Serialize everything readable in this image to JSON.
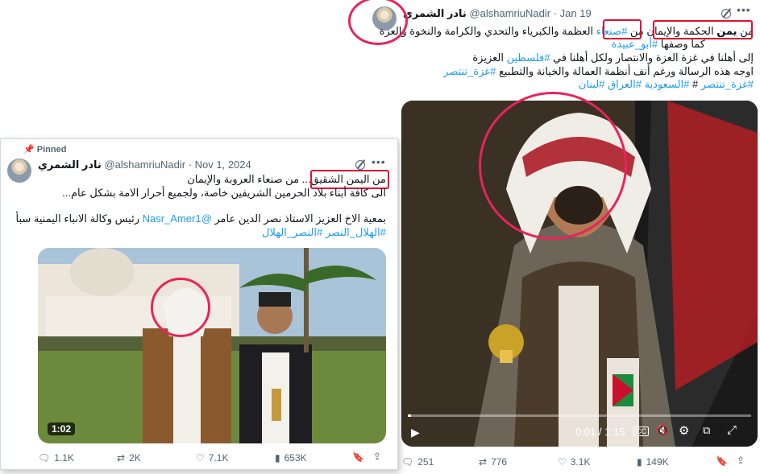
{
  "right_tweet": {
    "name": "نادر الشمري",
    "handle": "@alshamriuNadir",
    "date": "Jan 19",
    "line1": {
      "before": "من ",
      "bold": "يمن",
      "highlight": " الحكمة والإيمان",
      "mid": " من ",
      "hashtag": "#صنعاء",
      "after": " العظمة والكبرياء والتحدي والكرامة والنخوة والعزة"
    },
    "line2": {
      "text": "كما وصفها ",
      "hashtag": "#أبو_عبيدة"
    },
    "line3": {
      "text": "إلى أهلنا في غزة العزة والانتصار ولكل أهلنا في ",
      "hashtag": "#فلسطين",
      "after": " العزيزة"
    },
    "line4": {
      "text": "اوجه هذه الرسالة ورغم أنف أنظمة العمالة والخيانة والتطبيع ",
      "hashtag": "#غزة_تنتصر"
    },
    "line5": {
      "tags": [
        "#غزة_تنتصر",
        "#",
        "#السعودية",
        "#العراق",
        "#لبنان"
      ]
    },
    "video": {
      "time": "0:01 / 1:15",
      "cc": "CC"
    },
    "actions": {
      "replies": "251",
      "reposts": "776",
      "likes": "3.1K",
      "views": "149K"
    }
  },
  "left_tweet": {
    "pinned_label": "Pinned",
    "name": "نادر الشمري",
    "handle": "@alshamriuNadir",
    "date": "Nov 1, 2024",
    "line1": {
      "highlight": "من اليمن الشقيق",
      "after": "... من صنعاء العروبة والإيمان"
    },
    "line2": "الى كافة أبناء بلاد الحرمين الشريفين خاصة، ولجميع أحرار الامة بشكل عام...",
    "line3": {
      "text": "بمعية الاخ العزيز الاستاذ نصر الدين عامر ",
      "mention": "@Nasr_Amer1",
      "after": " رئيس وكالة الانباء اليمنية سبأ"
    },
    "line4": {
      "tags": [
        "#الهلال_النصر",
        "#النصر_الهلال"
      ]
    },
    "video": {
      "duration": "1:02"
    },
    "actions": {
      "replies": "1.1K",
      "reposts": "2K",
      "likes": "7.1K",
      "views": "653K"
    }
  },
  "colors": {
    "link": "#1d9bf0",
    "annotation_red": "#e0102f",
    "annotation_ring": "#e8245a",
    "muted": "#536471"
  }
}
